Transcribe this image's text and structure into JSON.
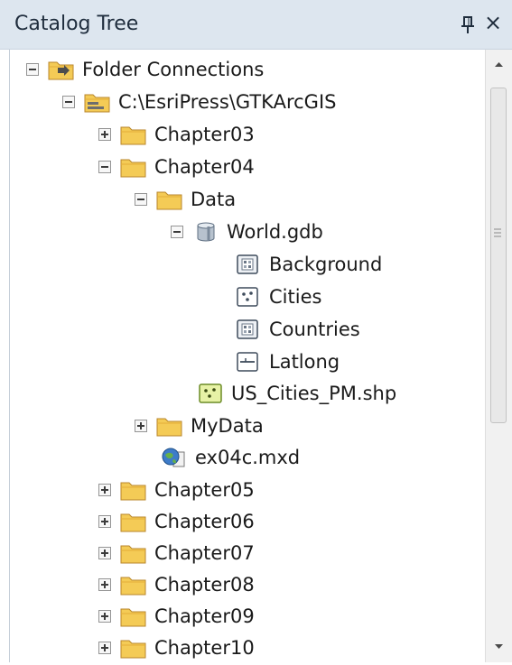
{
  "panel": {
    "title": "Catalog Tree",
    "pin_icon": "pin-icon",
    "close_label": "×"
  },
  "colors": {
    "titlebar_bg": "#dde6ef",
    "folder": "#f4cb56",
    "gdb": "#9aa8b8"
  },
  "tree": [
    {
      "label": "Folder Connections",
      "state": "expanded",
      "icon": "folder-connections-icon"
    },
    {
      "label": "C:\\EsriPress\\GTKArcGIS",
      "state": "expanded",
      "icon": "folder-connection-icon"
    },
    {
      "label": "Chapter03",
      "state": "collapsed",
      "icon": "folder-icon"
    },
    {
      "label": "Chapter04",
      "state": "expanded",
      "icon": "folder-icon"
    },
    {
      "label": "Data",
      "state": "expanded",
      "icon": "folder-icon"
    },
    {
      "label": "World.gdb",
      "state": "expanded",
      "icon": "geodatabase-icon"
    },
    {
      "label": "Background",
      "state": "none",
      "icon": "raster-dataset-icon"
    },
    {
      "label": "Cities",
      "state": "none",
      "icon": "point-feature-class-icon"
    },
    {
      "label": "Countries",
      "state": "none",
      "icon": "raster-dataset-icon"
    },
    {
      "label": "Latlong",
      "state": "none",
      "icon": "line-feature-class-icon"
    },
    {
      "label": "US_Cities_PM.shp",
      "state": "none",
      "icon": "shapefile-icon"
    },
    {
      "label": "MyData",
      "state": "collapsed",
      "icon": "folder-icon"
    },
    {
      "label": "ex04c.mxd",
      "state": "none",
      "icon": "map-document-icon"
    },
    {
      "label": "Chapter05",
      "state": "collapsed",
      "icon": "folder-icon"
    },
    {
      "label": "Chapter06",
      "state": "collapsed",
      "icon": "folder-icon"
    },
    {
      "label": "Chapter07",
      "state": "collapsed",
      "icon": "folder-icon"
    },
    {
      "label": "Chapter08",
      "state": "collapsed",
      "icon": "folder-icon"
    },
    {
      "label": "Chapter09",
      "state": "collapsed",
      "icon": "folder-icon"
    },
    {
      "label": "Chapter10",
      "state": "collapsed",
      "icon": "folder-icon"
    }
  ]
}
